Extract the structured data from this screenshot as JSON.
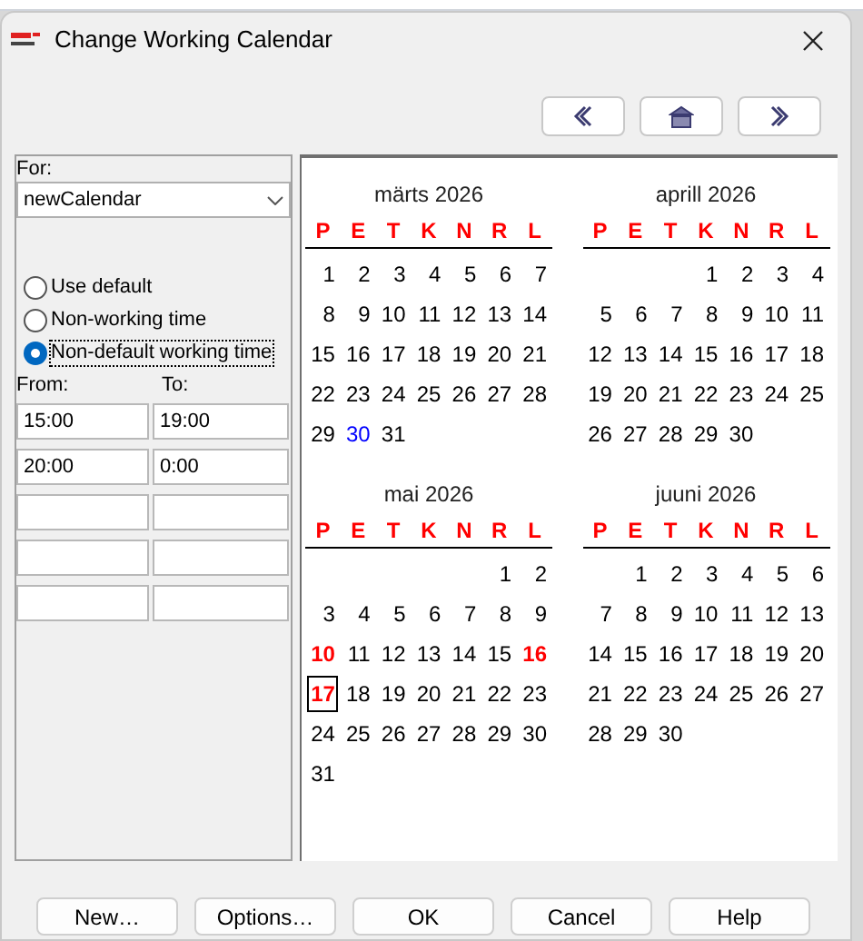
{
  "window": {
    "title": "Change Working Calendar"
  },
  "nav_buttons": [
    {
      "kind": "previous"
    },
    {
      "kind": "home"
    },
    {
      "kind": "next"
    }
  ],
  "for": {
    "label": "For:",
    "value": "newCalendar"
  },
  "options": [
    {
      "label": "Use default",
      "selected": false
    },
    {
      "label": "Non-working time",
      "selected": false
    },
    {
      "label": "Non-default working time",
      "selected": true
    }
  ],
  "time_columns": [
    "From:",
    "To:"
  ],
  "time_rows": [
    {
      "kind": "filled",
      "from": "15:00",
      "to": "19:00"
    },
    {
      "kind": "filled",
      "from": "20:00",
      "to": "0:00"
    },
    {
      "kind": "empty"
    },
    {
      "kind": "empty"
    },
    {
      "kind": "empty"
    }
  ],
  "months": [
    {
      "title": "märts 2026",
      "weekdays": [
        "P",
        "E",
        "T",
        "K",
        "N",
        "R",
        "L"
      ],
      "weeks": [
        [
          {
            "day": "1",
            "kind": "normal",
            "selected": false
          },
          {
            "day": "2",
            "kind": "normal",
            "selected": false
          },
          {
            "day": "3",
            "kind": "normal",
            "selected": false
          },
          {
            "day": "4",
            "kind": "normal",
            "selected": false
          },
          {
            "day": "5",
            "kind": "normal",
            "selected": false
          },
          {
            "day": "6",
            "kind": "normal",
            "selected": false
          },
          {
            "day": "7",
            "kind": "normal",
            "selected": false
          }
        ],
        [
          {
            "day": "8",
            "kind": "normal",
            "selected": false
          },
          {
            "day": "9",
            "kind": "normal",
            "selected": false
          },
          {
            "day": "10",
            "kind": "normal",
            "selected": false
          },
          {
            "day": "11",
            "kind": "normal",
            "selected": false
          },
          {
            "day": "12",
            "kind": "normal",
            "selected": false
          },
          {
            "day": "13",
            "kind": "normal",
            "selected": false
          },
          {
            "day": "14",
            "kind": "normal",
            "selected": false
          }
        ],
        [
          {
            "day": "15",
            "kind": "normal",
            "selected": false
          },
          {
            "day": "16",
            "kind": "normal",
            "selected": false
          },
          {
            "day": "17",
            "kind": "normal",
            "selected": false
          },
          {
            "day": "18",
            "kind": "normal",
            "selected": false
          },
          {
            "day": "19",
            "kind": "normal",
            "selected": false
          },
          {
            "day": "20",
            "kind": "normal",
            "selected": false
          },
          {
            "day": "21",
            "kind": "normal",
            "selected": false
          }
        ],
        [
          {
            "day": "22",
            "kind": "normal",
            "selected": false
          },
          {
            "day": "23",
            "kind": "normal",
            "selected": false
          },
          {
            "day": "24",
            "kind": "normal",
            "selected": false
          },
          {
            "day": "25",
            "kind": "normal",
            "selected": false
          },
          {
            "day": "26",
            "kind": "normal",
            "selected": false
          },
          {
            "day": "27",
            "kind": "normal",
            "selected": false
          },
          {
            "day": "28",
            "kind": "normal",
            "selected": false
          }
        ],
        [
          {
            "day": "29",
            "kind": "normal",
            "selected": false
          },
          {
            "day": "30",
            "kind": "today",
            "selected": false
          },
          {
            "day": "31",
            "kind": "normal",
            "selected": false
          }
        ]
      ]
    },
    {
      "title": "aprill 2026",
      "weekdays": [
        "P",
        "E",
        "T",
        "K",
        "N",
        "R",
        "L"
      ],
      "weeks": [
        [
          {
            "kind": "empty"
          },
          {
            "kind": "empty"
          },
          {
            "kind": "empty"
          },
          {
            "day": "1",
            "kind": "normal",
            "selected": false
          },
          {
            "day": "2",
            "kind": "normal",
            "selected": false
          },
          {
            "day": "3",
            "kind": "normal",
            "selected": false
          },
          {
            "day": "4",
            "kind": "normal",
            "selected": false
          }
        ],
        [
          {
            "day": "5",
            "kind": "normal",
            "selected": false
          },
          {
            "day": "6",
            "kind": "normal",
            "selected": false
          },
          {
            "day": "7",
            "kind": "normal",
            "selected": false
          },
          {
            "day": "8",
            "kind": "normal",
            "selected": false
          },
          {
            "day": "9",
            "kind": "normal",
            "selected": false
          },
          {
            "day": "10",
            "kind": "normal",
            "selected": false
          },
          {
            "day": "11",
            "kind": "normal",
            "selected": false
          }
        ],
        [
          {
            "day": "12",
            "kind": "normal",
            "selected": false
          },
          {
            "day": "13",
            "kind": "normal",
            "selected": false
          },
          {
            "day": "14",
            "kind": "normal",
            "selected": false
          },
          {
            "day": "15",
            "kind": "normal",
            "selected": false
          },
          {
            "day": "16",
            "kind": "normal",
            "selected": false
          },
          {
            "day": "17",
            "kind": "normal",
            "selected": false
          },
          {
            "day": "18",
            "kind": "normal",
            "selected": false
          }
        ],
        [
          {
            "day": "19",
            "kind": "normal",
            "selected": false
          },
          {
            "day": "20",
            "kind": "normal",
            "selected": false
          },
          {
            "day": "21",
            "kind": "normal",
            "selected": false
          },
          {
            "day": "22",
            "kind": "normal",
            "selected": false
          },
          {
            "day": "23",
            "kind": "normal",
            "selected": false
          },
          {
            "day": "24",
            "kind": "normal",
            "selected": false
          },
          {
            "day": "25",
            "kind": "normal",
            "selected": false
          }
        ],
        [
          {
            "day": "26",
            "kind": "normal",
            "selected": false
          },
          {
            "day": "27",
            "kind": "normal",
            "selected": false
          },
          {
            "day": "28",
            "kind": "normal",
            "selected": false
          },
          {
            "day": "29",
            "kind": "normal",
            "selected": false
          },
          {
            "day": "30",
            "kind": "normal",
            "selected": false
          }
        ]
      ]
    },
    {
      "title": "mai 2026",
      "weekdays": [
        "P",
        "E",
        "T",
        "K",
        "N",
        "R",
        "L"
      ],
      "weeks": [
        [
          {
            "kind": "empty"
          },
          {
            "kind": "empty"
          },
          {
            "kind": "empty"
          },
          {
            "kind": "empty"
          },
          {
            "kind": "empty"
          },
          {
            "day": "1",
            "kind": "normal",
            "selected": false
          },
          {
            "day": "2",
            "kind": "normal",
            "selected": false
          }
        ],
        [
          {
            "day": "3",
            "kind": "normal",
            "selected": false
          },
          {
            "day": "4",
            "kind": "normal",
            "selected": false
          },
          {
            "day": "5",
            "kind": "normal",
            "selected": false
          },
          {
            "day": "6",
            "kind": "normal",
            "selected": false
          },
          {
            "day": "7",
            "kind": "normal",
            "selected": false
          },
          {
            "day": "8",
            "kind": "normal",
            "selected": false
          },
          {
            "day": "9",
            "kind": "normal",
            "selected": false
          }
        ],
        [
          {
            "day": "10",
            "kind": "exception",
            "selected": false
          },
          {
            "day": "11",
            "kind": "normal",
            "selected": false
          },
          {
            "day": "12",
            "kind": "normal",
            "selected": false
          },
          {
            "day": "13",
            "kind": "normal",
            "selected": false
          },
          {
            "day": "14",
            "kind": "normal",
            "selected": false
          },
          {
            "day": "15",
            "kind": "normal",
            "selected": false
          },
          {
            "day": "16",
            "kind": "exception",
            "selected": false
          }
        ],
        [
          {
            "day": "17",
            "kind": "exception",
            "selected": true
          },
          {
            "day": "18",
            "kind": "normal",
            "selected": false
          },
          {
            "day": "19",
            "kind": "normal",
            "selected": false
          },
          {
            "day": "20",
            "kind": "normal",
            "selected": false
          },
          {
            "day": "21",
            "kind": "normal",
            "selected": false
          },
          {
            "day": "22",
            "kind": "normal",
            "selected": false
          },
          {
            "day": "23",
            "kind": "normal",
            "selected": false
          }
        ],
        [
          {
            "day": "24",
            "kind": "normal",
            "selected": false
          },
          {
            "day": "25",
            "kind": "normal",
            "selected": false
          },
          {
            "day": "26",
            "kind": "normal",
            "selected": false
          },
          {
            "day": "27",
            "kind": "normal",
            "selected": false
          },
          {
            "day": "28",
            "kind": "normal",
            "selected": false
          },
          {
            "day": "29",
            "kind": "normal",
            "selected": false
          },
          {
            "day": "30",
            "kind": "normal",
            "selected": false
          }
        ],
        [
          {
            "day": "31",
            "kind": "normal",
            "selected": false
          }
        ]
      ]
    },
    {
      "title": "juuni 2026",
      "weekdays": [
        "P",
        "E",
        "T",
        "K",
        "N",
        "R",
        "L"
      ],
      "weeks": [
        [
          {
            "kind": "empty"
          },
          {
            "day": "1",
            "kind": "normal",
            "selected": false
          },
          {
            "day": "2",
            "kind": "normal",
            "selected": false
          },
          {
            "day": "3",
            "kind": "normal",
            "selected": false
          },
          {
            "day": "4",
            "kind": "normal",
            "selected": false
          },
          {
            "day": "5",
            "kind": "normal",
            "selected": false
          },
          {
            "day": "6",
            "kind": "normal",
            "selected": false
          }
        ],
        [
          {
            "day": "7",
            "kind": "normal",
            "selected": false
          },
          {
            "day": "8",
            "kind": "normal",
            "selected": false
          },
          {
            "day": "9",
            "kind": "normal",
            "selected": false
          },
          {
            "day": "10",
            "kind": "normal",
            "selected": false
          },
          {
            "day": "11",
            "kind": "normal",
            "selected": false
          },
          {
            "day": "12",
            "kind": "normal",
            "selected": false
          },
          {
            "day": "13",
            "kind": "normal",
            "selected": false
          }
        ],
        [
          {
            "day": "14",
            "kind": "normal",
            "selected": false
          },
          {
            "day": "15",
            "kind": "normal",
            "selected": false
          },
          {
            "day": "16",
            "kind": "normal",
            "selected": false
          },
          {
            "day": "17",
            "kind": "normal",
            "selected": false
          },
          {
            "day": "18",
            "kind": "normal",
            "selected": false
          },
          {
            "day": "19",
            "kind": "normal",
            "selected": false
          },
          {
            "day": "20",
            "kind": "normal",
            "selected": false
          }
        ],
        [
          {
            "day": "21",
            "kind": "normal",
            "selected": false
          },
          {
            "day": "22",
            "kind": "normal",
            "selected": false
          },
          {
            "day": "23",
            "kind": "normal",
            "selected": false
          },
          {
            "day": "24",
            "kind": "normal",
            "selected": false
          },
          {
            "day": "25",
            "kind": "normal",
            "selected": false
          },
          {
            "day": "26",
            "kind": "normal",
            "selected": false
          },
          {
            "day": "27",
            "kind": "normal",
            "selected": false
          }
        ],
        [
          {
            "day": "28",
            "kind": "normal",
            "selected": false
          },
          {
            "day": "29",
            "kind": "normal",
            "selected": false
          },
          {
            "day": "30",
            "kind": "normal",
            "selected": false
          }
        ]
      ]
    }
  ],
  "buttons": [
    "New…",
    "Options…",
    "OK",
    "Cancel",
    "Help"
  ]
}
